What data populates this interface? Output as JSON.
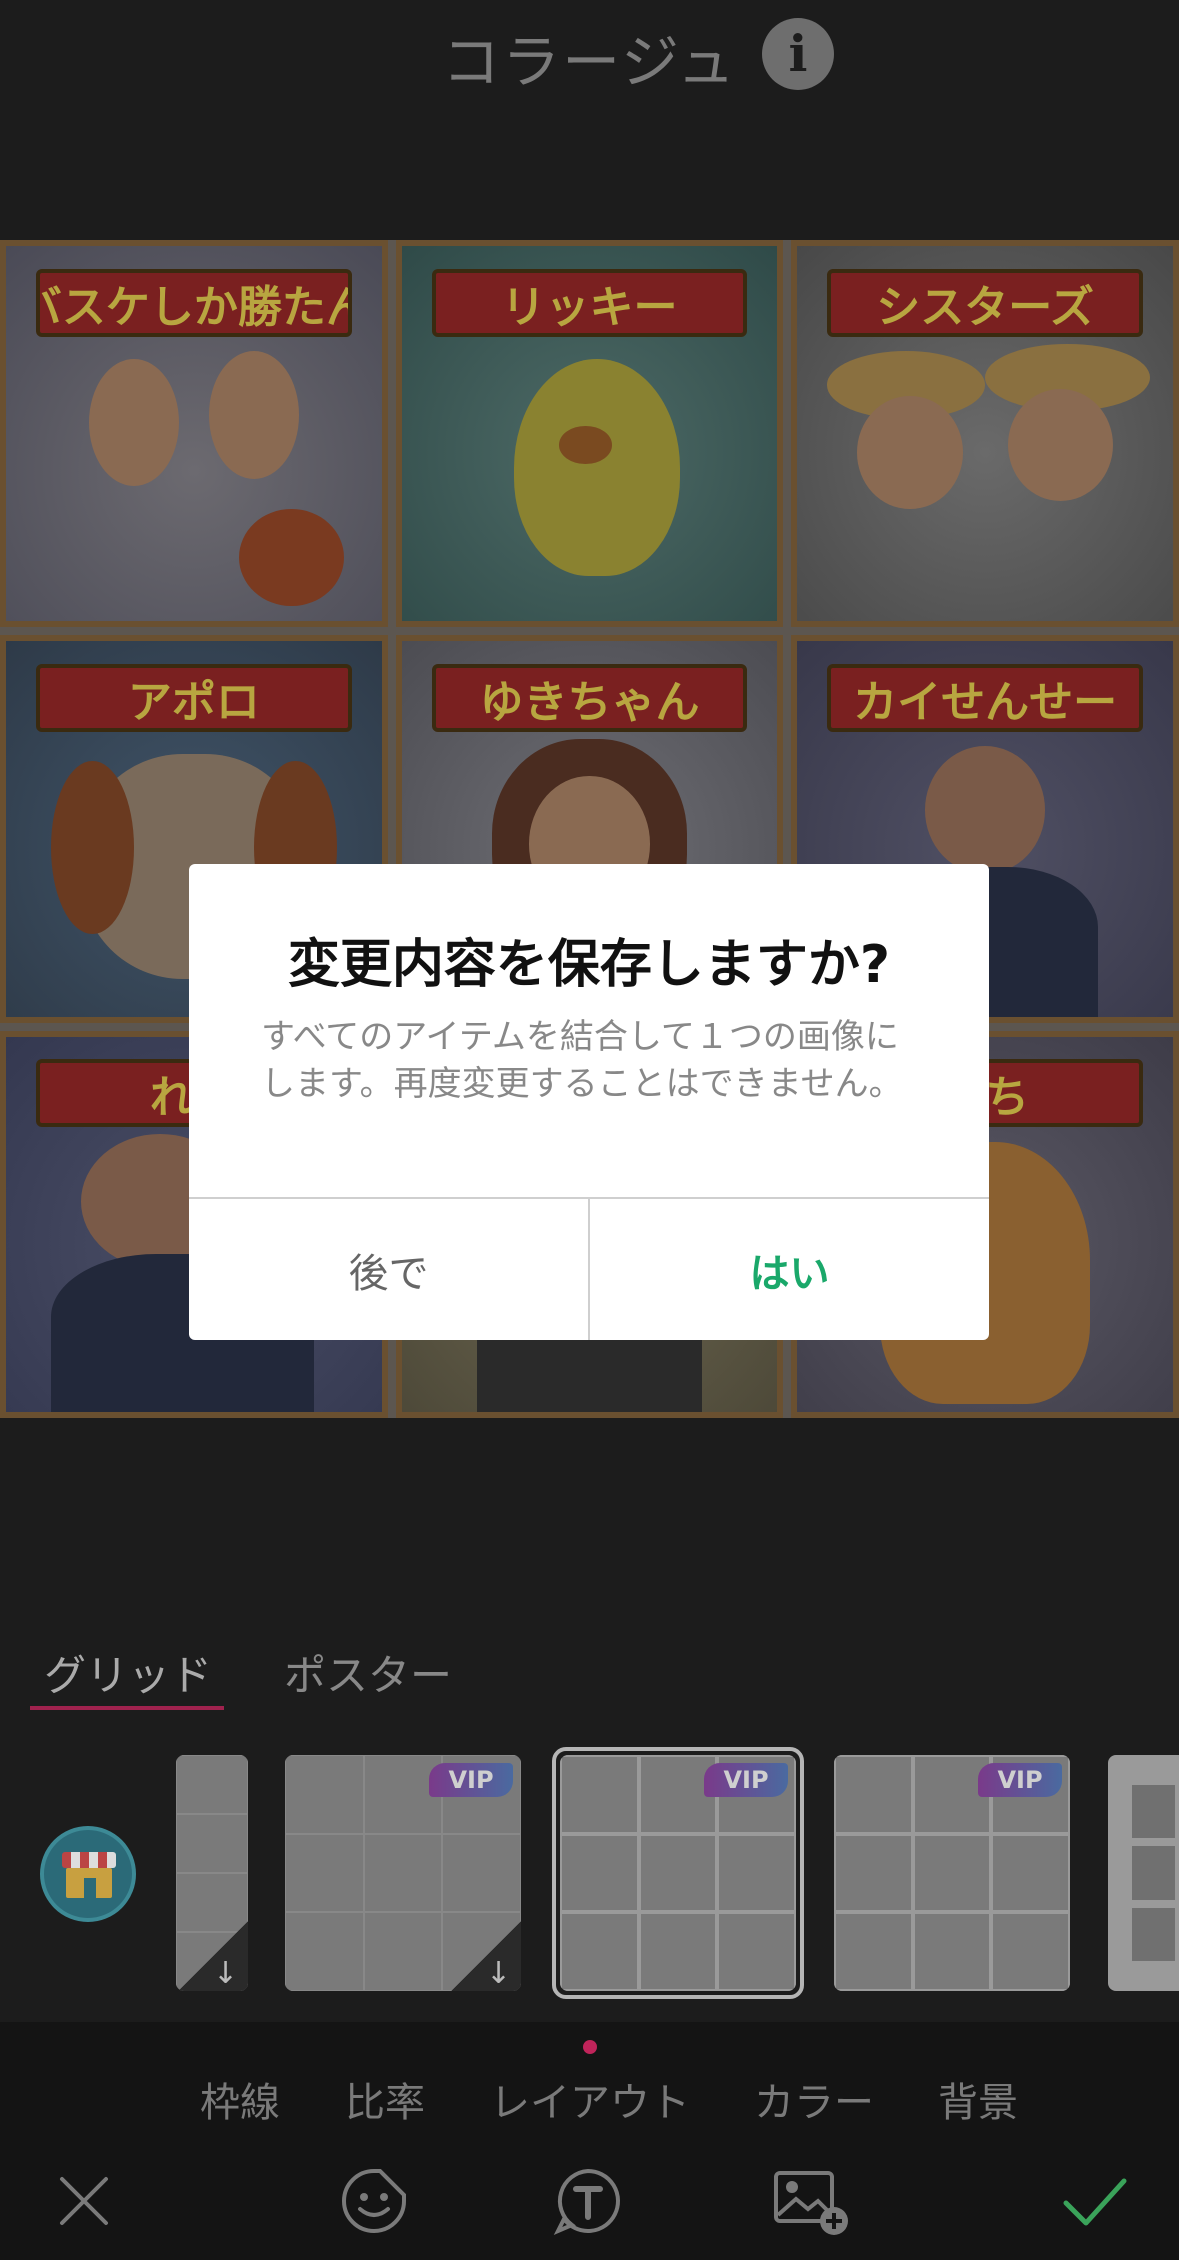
{
  "header": {
    "title": "コラージュ",
    "info_icon": "info-icon"
  },
  "collage": {
    "cells": [
      {
        "label": "バスケしか勝たん"
      },
      {
        "label": "リッキー"
      },
      {
        "label": "シスターズ"
      },
      {
        "label": "アポロ"
      },
      {
        "label": "ゆきちゃん"
      },
      {
        "label": "カイせんせー"
      },
      {
        "label": "れん"
      },
      {
        "label": ""
      },
      {
        "label": "もち"
      }
    ]
  },
  "dialog": {
    "title": "変更内容を保存しますか?",
    "message": "すべてのアイテムを結合して１つの画像にします。再度変更することはできません。",
    "later_label": "後で",
    "yes_label": "はい",
    "yes_color": "#1aa86a"
  },
  "category_tabs": [
    {
      "label": "グリッド",
      "active": true
    },
    {
      "label": "ポスター",
      "active": false
    }
  ],
  "layouts": {
    "vip_label": "VIP",
    "items": [
      {
        "vip": false,
        "download": true
      },
      {
        "vip": true,
        "download": true
      },
      {
        "vip": true,
        "download": false,
        "selected": true
      },
      {
        "vip": true,
        "download": false
      },
      {
        "vip": false,
        "download": false
      }
    ]
  },
  "tools": [
    {
      "label": "枠線"
    },
    {
      "label": "比率"
    },
    {
      "label": "レイアウト",
      "active": true
    },
    {
      "label": "カラー"
    },
    {
      "label": "背景"
    }
  ],
  "bottom_bar": [
    "close-icon",
    "sticker-icon",
    "text-icon",
    "add-photo-icon",
    "check-icon"
  ],
  "colors": {
    "accent": "#c0245a",
    "confirm": "#3aa35a"
  }
}
